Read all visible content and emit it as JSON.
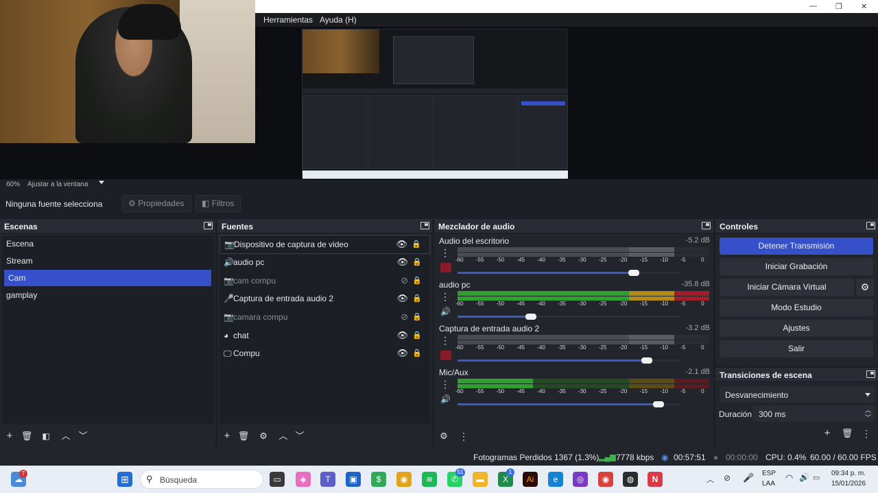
{
  "preview": {
    "menu": [
      "Herramientas",
      "Ayuda (H)"
    ],
    "zoom": "60%",
    "fit_label": "Ajustar a la ventana"
  },
  "context_bar": {
    "no_selection": "Ninguna fuente selecciona",
    "properties": "Propiedades",
    "filters": "Filtros"
  },
  "scenes": {
    "title": "Escenas",
    "items": [
      {
        "label": "Escena"
      },
      {
        "label": "Stream"
      },
      {
        "label": "Cam"
      },
      {
        "label": "gamplay"
      }
    ],
    "selected_index": 2
  },
  "sources": {
    "title": "Fuentes",
    "items": [
      {
        "label": "Dispositivo de captura de video",
        "icon": "camera-icon",
        "visible": true
      },
      {
        "label": "audio pc",
        "icon": "speaker-icon",
        "visible": true
      },
      {
        "label": "cam compu",
        "icon": "camera-icon",
        "visible": false
      },
      {
        "label": "Captura de entrada audio 2",
        "icon": "microphone-icon",
        "visible": true
      },
      {
        "label": "camara compu",
        "icon": "camera-icon",
        "visible": false
      },
      {
        "label": "chat",
        "icon": "globe-icon",
        "visible": true
      },
      {
        "label": "Compu",
        "icon": "monitor-icon",
        "visible": true
      }
    ]
  },
  "mixer": {
    "title": "Mezclador de audio",
    "scale": [
      "-60",
      "-55",
      "-50",
      "-45",
      "-40",
      "-35",
      "-30",
      "-25",
      "-20",
      "-15",
      "-10",
      "-5",
      "0"
    ],
    "channels": [
      {
        "name": "Audio del escritorio",
        "db": "-5.2 dB",
        "muted": true,
        "volume": 0.79,
        "level": 0.0
      },
      {
        "name": "audio pc",
        "db": "-35.8 dB",
        "muted": false,
        "volume": 0.33,
        "level": 1.0
      },
      {
        "name": "Captura de entrada audio 2",
        "db": "-3.2 dB",
        "muted": true,
        "volume": 0.85,
        "level": 0.0
      },
      {
        "name": "Mic/Aux",
        "db": "-2.1 dB",
        "muted": false,
        "volume": 0.9,
        "level": 0.3
      }
    ]
  },
  "controls": {
    "title": "Controles",
    "buttons": [
      "Detener Transmisión",
      "Iniciar Grabación",
      "Iniciar Cámara Virtual",
      "Modo Estudio",
      "Ajustes",
      "Salir"
    ]
  },
  "transitions": {
    "title": "Transiciones de escena",
    "selected": "Desvanecimiento",
    "duration_label": "Duración",
    "duration_value": "300 ms"
  },
  "status": {
    "dropped": "Fotogramas Perdidos 1367 (1.3%)",
    "bitrate": "7778 kbps",
    "stream_time": "00:57:51",
    "rec_time": "00:00:00",
    "cpu": "CPU: 0.4%",
    "fps": "60.00 / 60.00 FPS"
  },
  "taskbar": {
    "search": "Búsqueda",
    "lang_top": "ESP",
    "lang_bottom": "LAA",
    "time": "09:34 p. m.",
    "date": "15/01/2026",
    "widget_badge": "7",
    "whatsapp_badge": "51",
    "excel_badge": "1"
  },
  "colors": {
    "accent": "#3550c8",
    "panel": "#23252c",
    "meter_green": "#2fa02f",
    "meter_yellow": "#b38a18",
    "meter_red": "#a31d2a"
  }
}
